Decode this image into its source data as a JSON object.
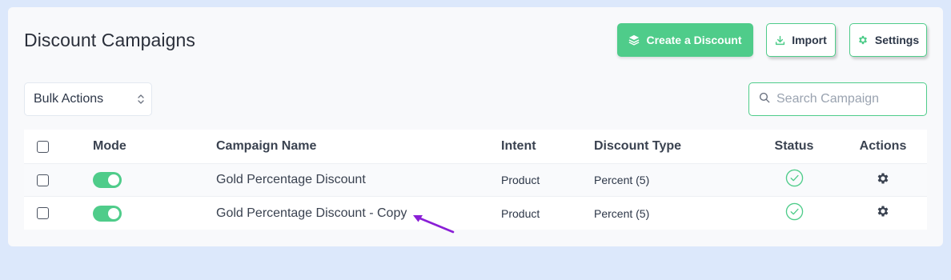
{
  "header": {
    "title": "Discount Campaigns",
    "create_label": "Create a Discount",
    "import_label": "Import",
    "settings_label": "Settings"
  },
  "toolbar": {
    "bulk_actions": "Bulk Actions",
    "search_placeholder": "Search Campaign"
  },
  "table": {
    "columns": {
      "mode": "Mode",
      "name": "Campaign Name",
      "intent": "Intent",
      "discount_type": "Discount Type",
      "status": "Status",
      "actions": "Actions"
    },
    "rows": [
      {
        "mode": "on",
        "name": "Gold Percentage Discount",
        "intent": "Product",
        "discount_type": "Percent (5)",
        "status": "active"
      },
      {
        "mode": "on",
        "name": "Gold Percentage Discount - Copy",
        "intent": "Product",
        "discount_type": "Percent (5)",
        "status": "active"
      }
    ]
  },
  "icons": {
    "create": "layers-icon",
    "import": "download-icon",
    "settings": "gear-icon",
    "search": "search-icon",
    "status": "check-circle-icon",
    "row_action": "gear-icon",
    "annotation": "arrow-icon"
  },
  "colors": {
    "accent": "#4fcc8a",
    "background": "#dce8fb",
    "annotation_arrow": "#8a1fd6"
  }
}
